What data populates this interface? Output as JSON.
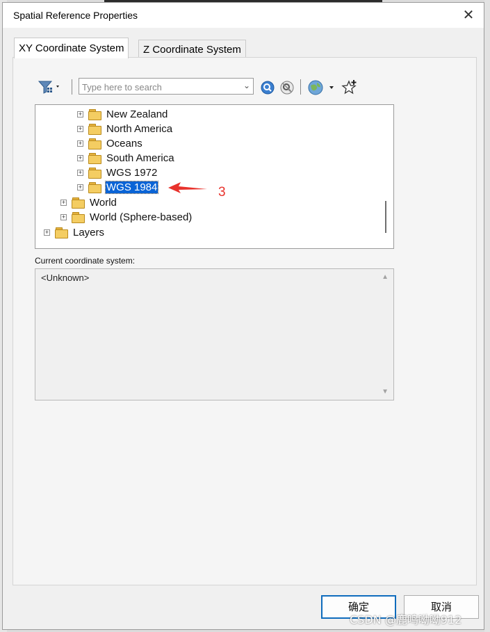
{
  "window": {
    "title": "Spatial Reference Properties",
    "close_glyph": "✕"
  },
  "tabs": [
    {
      "label": "XY Coordinate System",
      "active": true
    },
    {
      "label": "Z Coordinate System",
      "active": false
    }
  ],
  "toolbar": {
    "search_placeholder": "Type here to search",
    "icons": [
      "filter-icon",
      "search-icon",
      "clear-search-icon",
      "globe-icon",
      "favorite-add-icon"
    ]
  },
  "tree": {
    "items": [
      {
        "label": "New Zealand",
        "level": 2
      },
      {
        "label": "North America",
        "level": 2
      },
      {
        "label": "Oceans",
        "level": 2
      },
      {
        "label": "South America",
        "level": 2
      },
      {
        "label": "WGS 1972",
        "level": 2
      },
      {
        "label": "WGS 1984",
        "level": 2,
        "selected": true
      },
      {
        "label": "World",
        "level": 1
      },
      {
        "label": "World (Sphere-based)",
        "level": 1
      },
      {
        "label": "Layers",
        "level": 0
      }
    ],
    "expander_glyph": "+"
  },
  "annotation": {
    "number": "3",
    "color": "#e8322c"
  },
  "current_cs": {
    "label": "Current coordinate system:",
    "value": "<Unknown>"
  },
  "buttons": {
    "ok": "确定",
    "cancel": "取消"
  },
  "watermark": "CSDN @鹿鸣呦呦912",
  "colors": {
    "selection": "#0a64d6",
    "accent_button_border": "#0f6cbd"
  }
}
